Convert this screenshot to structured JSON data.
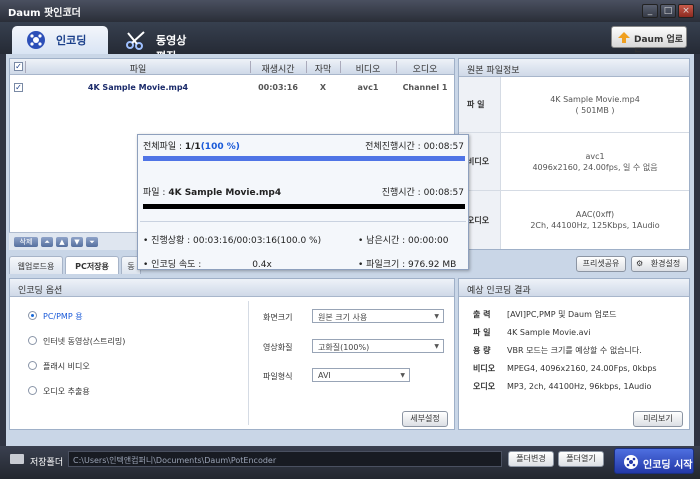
{
  "window": {
    "title": "Daum 팟인코더",
    "minimize": "_",
    "maximize": "□",
    "close": "×"
  },
  "tabs": {
    "encoding": "인코딩",
    "edit": "동영상 편집",
    "upload": "Daum 업로드"
  },
  "filelist": {
    "headers": [
      "파일",
      "재생시간",
      "자막",
      "비디오",
      "오디오"
    ],
    "rows": [
      {
        "file": "4K Sample Movie.mp4",
        "duration": "00:03:16",
        "subtitle": "X",
        "video": "avc1",
        "audio": "Channel 1"
      }
    ],
    "delete_label": "삭제"
  },
  "source_info": {
    "title": "원본 파일정보",
    "file_label": "파 일",
    "file_line1": "4K Sample Movie.mp4",
    "file_line2": "( 501MB )",
    "video_label": "비디오",
    "video_line1": "avc1",
    "video_line2": "4096x2160, 24.00fps, 일 수 없음",
    "audio_label": "오디오",
    "audio_line1": "AAC(0xff)",
    "audio_line2": "2Ch, 44100Hz, 125Kbps, 1Audio"
  },
  "progress": {
    "total_files_label": "전체파일 : ",
    "total_files": "1/1",
    "total_percent": "(100 %)",
    "total_time_label": "전체진행시간 : ",
    "total_time": "00:08:57",
    "file_label": "파일 : ",
    "file_name": "4K Sample Movie.mp4",
    "time_label": "진행시간 : ",
    "time": "00:08:57",
    "status_label": "• 진행상황 : ",
    "status": "00:03:16/00:03:16(100.0 %)",
    "remain_label": "• 남은시간 : ",
    "remain": "00:00:00",
    "speed_label": "• 인코딩 속도 : ",
    "speed": "0.4x",
    "size_label": "• 파일크기 : ",
    "size": "976.92 MB",
    "total_fill": 1.0,
    "file_fill": 1.0
  },
  "subtabs": {
    "web": "웹업로드용",
    "pc": "PC저장용",
    "third": "동"
  },
  "buttons": {
    "preset": "프리셋공유",
    "settings": "환경설정",
    "detail": "세부설정",
    "preview": "미리보기",
    "folder_change": "폴더변경",
    "folder_open": "폴더열기",
    "encode": "인코딩 시작"
  },
  "options": {
    "title": "인코딩 옵션",
    "radios": [
      "PC/PMP 용",
      "인터넷 동영상(스트리밍)",
      "플래시 비디오",
      "오디오 추출용"
    ],
    "size_label": "화면크기",
    "size_value": "원본 크기 사용",
    "quality_label": "영상화질",
    "quality_value": "고화질(100%)",
    "format_label": "파일형식",
    "format_value": "AVI"
  },
  "result": {
    "title": "예상 인코딩 결과",
    "rows": [
      {
        "label": "출 력",
        "value": "[AVI]PC,PMP 및 Daum 업로드"
      },
      {
        "label": "파 일",
        "value": "4K Sample Movie.avi"
      },
      {
        "label": "용 량",
        "value": "VBR 모드는 크기를 예상할 수 없습니다."
      },
      {
        "label": "비디오",
        "value": "MPEG4, 4096x2160, 24.00Fps, 0kbps"
      },
      {
        "label": "오디오",
        "value": "MP3, 2ch, 44100Hz, 96kbps, 1Audio"
      }
    ]
  },
  "footer": {
    "folder_label": "저장폴더",
    "folder_path": "C:\\Users\\인텍앤컴퍼니\\Documents\\Daum\\PotEncoder"
  },
  "colors": {
    "accent": "#1a5ad8",
    "progress": "#4f74e6"
  }
}
